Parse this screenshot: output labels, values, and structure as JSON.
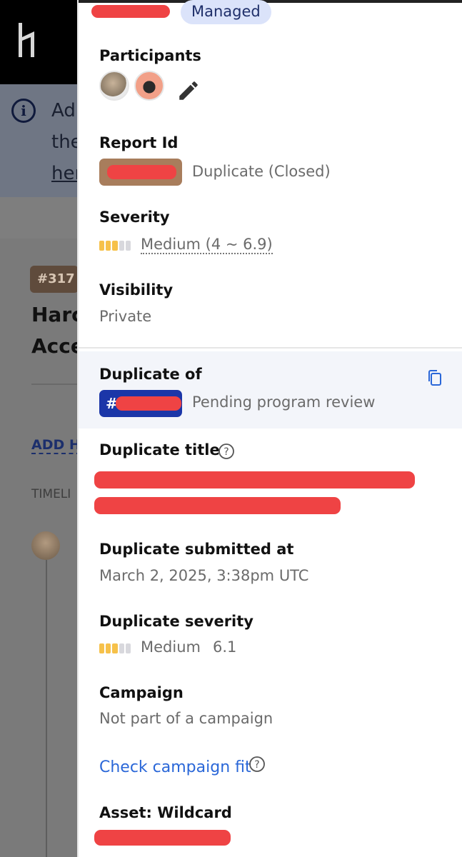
{
  "background": {
    "info_text_line1": "Ad",
    "info_text_line2": "the",
    "info_text_line3": "her",
    "report_tag": "#317",
    "title_line1": "Harc",
    "title_line2": "Acce",
    "add_link": "ADD H",
    "timeline_label": "TIMELI"
  },
  "panel": {
    "managed_label": "Managed",
    "participants": {
      "label": "Participants",
      "icons": [
        "avatar-participant-1",
        "avatar-participant-2",
        "pencil-icon"
      ]
    },
    "report_id": {
      "label": "Report Id",
      "status": "Duplicate (Closed)"
    },
    "severity": {
      "label": "Severity",
      "value": "Medium (4 ~ 6.9)",
      "bars_filled": 3,
      "bars_total": 5
    },
    "visibility": {
      "label": "Visibility",
      "value": "Private"
    },
    "duplicate_of": {
      "label": "Duplicate of",
      "chip_prefix": "#",
      "status": "Pending program review"
    },
    "duplicate_title": {
      "label": "Duplicate title"
    },
    "duplicate_submitted_at": {
      "label": "Duplicate submitted at",
      "value": "March 2, 2025, 3:38pm UTC"
    },
    "duplicate_severity": {
      "label": "Duplicate severity",
      "rating": "Medium",
      "score": "6.1",
      "bars_filled": 3,
      "bars_total": 5
    },
    "campaign": {
      "label": "Campaign",
      "value": "Not part of a campaign",
      "link": "Check campaign fit"
    },
    "asset": {
      "label": "Asset: Wildcard"
    }
  },
  "colors": {
    "accent_link": "#2a67d8",
    "managed_pill": "#dbe3fa",
    "duplicate_chip": "#1b36a8",
    "report_chip": "#a87d5c",
    "severity_on": "#f6c14a",
    "redaction": "#ef4344"
  }
}
